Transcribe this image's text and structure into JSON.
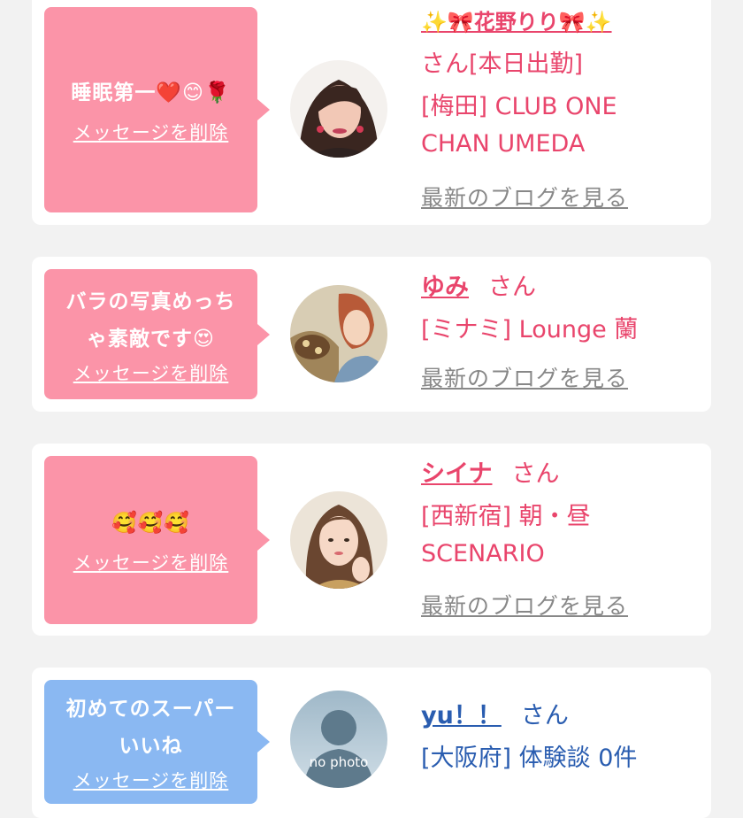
{
  "cards": [
    {
      "message": "睡眠第一❤️😊🌹",
      "delete_label": "メッセージを削除",
      "name": "✨🎀花野りり🎀✨",
      "honorific": "さん[本日出勤]",
      "shop_lines": [
        "[梅田] CLUB ONE",
        "CHAN UMEDA"
      ],
      "blog_link": "最新のブログを見る",
      "avatar_alt": "avatar-photo"
    },
    {
      "message_lines": [
        "バラの写真めっち",
        "ゃ素敵です😍"
      ],
      "delete_label": "メッセージを削除",
      "name": "ゆみ",
      "honorific": "さん",
      "shop_lines": [
        "[ミナミ] Lounge 蘭"
      ],
      "blog_link": "最新のブログを見る"
    },
    {
      "message": "🥰🥰🥰",
      "delete_label": "メッセージを削除",
      "name": "シイナ",
      "honorific": "さん",
      "shop_lines": [
        "[西新宿] 朝・昼",
        "SCENARIO"
      ],
      "blog_link": "最新のブログを見る"
    },
    {
      "message_lines": [
        "初めてのスーパー",
        "いいね"
      ],
      "delete_label": "メッセージを削除",
      "name": "yu！！",
      "honorific": "さん",
      "shop_lines": [
        "[大阪府] 体験談 0件"
      ],
      "no_photo_label": "no photo"
    }
  ],
  "colors": {
    "pink_bubble": "#fb94a8",
    "blue_bubble": "#8ab8f2",
    "pink_text": "#e9456c",
    "blue_text": "#2a5db0"
  }
}
